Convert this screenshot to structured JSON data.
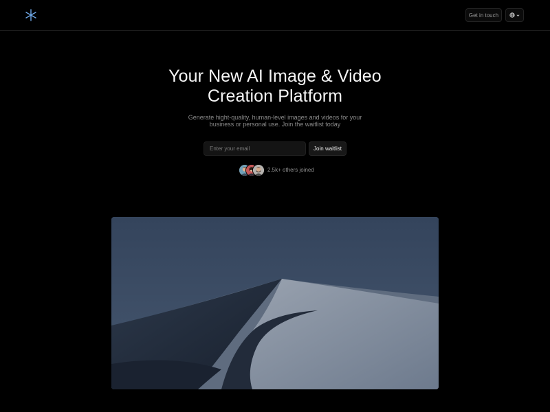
{
  "header": {
    "logo_icon": "asterisk-snowflake-icon",
    "contact_label": "Get in touch",
    "language_icon": "globe-icon",
    "language_chevron": "chevron-down-icon"
  },
  "hero": {
    "title_line1": "Your New AI Image & Video",
    "title_line2": "Creation Platform",
    "subtitle_line1": "Generate hight-quality, human-level images and videos for your",
    "subtitle_line2": "business or personal use. Join the waitlist today",
    "email_placeholder": "Enter your email",
    "join_label": "Join waitlist"
  },
  "social_proof": {
    "joined_text": "2.5k+ others joined",
    "avatars": [
      "avatar-1",
      "avatar-2",
      "avatar-3"
    ]
  },
  "showcase": {
    "image": "desert-dune-night-image"
  },
  "colors": {
    "background": "#000000",
    "logo_accent": "#6fa8e8",
    "sky": "#3a4a62",
    "dune_light": "#8d97a6",
    "dune_shadow": "#1f2838"
  }
}
